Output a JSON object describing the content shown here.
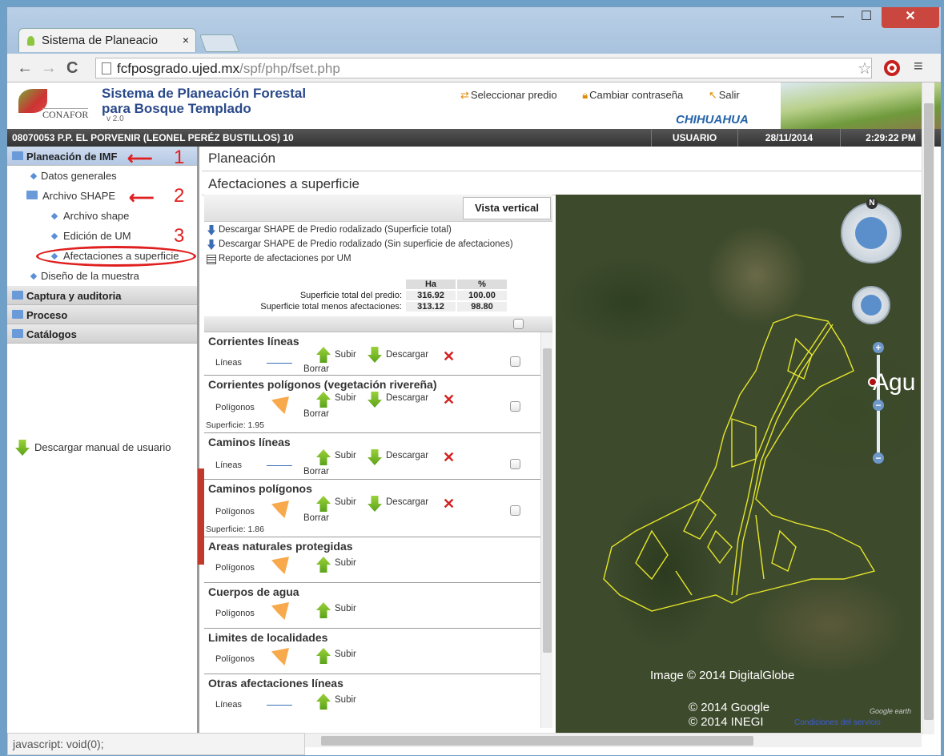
{
  "browser": {
    "tab_title": "Sistema de Planeacio",
    "tab_close": "×",
    "url_host": "fcfposgrado.ujed.mx",
    "url_path": "/spf/php/fset.php",
    "status_text": "javascript: void(0);"
  },
  "header": {
    "logo_text": "CONAFOR",
    "app_title_line1": "Sistema de Planeación Forestal",
    "app_title_line2": "para Bosque Templado",
    "version": "v 2.0",
    "links": [
      "Seleccionar predio",
      "Cambiar contraseña",
      "Salir"
    ],
    "state": "CHIHUAHUA"
  },
  "infobar": {
    "predio": "08070053 P.P. EL PORVENIR (LEONEL PERÉZ BUSTILLOS) 10",
    "user": "USUARIO",
    "date": "28/11/2014",
    "time": "2:29:22 PM"
  },
  "sidebar": {
    "planeacion": "Planeación de IMF",
    "datos_generales": "Datos generales",
    "archivo_shape_folder": "Archivo SHAPE",
    "archivo_shape": "Archivo shape",
    "edicion_um": "Edición de UM",
    "afectaciones": "Afectaciones a superficie",
    "diseno": "Diseño de la muestra",
    "captura": "Captura y auditoria",
    "proceso": "Proceso",
    "catalogos": "Catálogos",
    "manual": "Descargar manual de usuario",
    "annot_1": "1",
    "annot_2": "2",
    "annot_3": "3"
  },
  "main": {
    "title": "Planeación",
    "subtitle": "Afectaciones a superficie",
    "vista_btn": "Vista vertical",
    "dl1": "Descargar SHAPE de Predio rodalizado (Superficie total)",
    "dl2": "Descargar SHAPE de Predio rodalizado (Sin superficie de afectaciones)",
    "report": "Reporte de afectaciones por UM",
    "sup_table": {
      "col_ha": "Ha",
      "col_pct": "%",
      "row1_label": "Superficie total del predio:",
      "row1_ha": "316.92",
      "row1_pct": "100.00",
      "row2_label": "Superficie total menos afectaciones:",
      "row2_ha": "313.12",
      "row2_pct": "98.80"
    },
    "sections": [
      {
        "title": "Corrientes líneas",
        "type": "Líneas",
        "upload": "Subir",
        "download": "Descargar",
        "delete": "Borrar",
        "area": ""
      },
      {
        "title": "Corrientes polígonos (vegetación rivereña)",
        "type": "Polígonos",
        "upload": "Subir",
        "download": "Descargar",
        "delete": "Borrar",
        "area": "Superficie: 1.95"
      },
      {
        "title": "Caminos líneas",
        "type": "Líneas",
        "upload": "Subir",
        "download": "Descargar",
        "delete": "Borrar",
        "area": ""
      },
      {
        "title": "Caminos polígonos",
        "type": "Polígonos",
        "upload": "Subir",
        "download": "Descargar",
        "delete": "Borrar",
        "area": "Superficie: 1.86"
      },
      {
        "title": "Areas naturales protegidas",
        "type": "Polígonos",
        "upload": "Subir"
      },
      {
        "title": "Cuerpos de agua",
        "type": "Polígonos",
        "upload": "Subir"
      },
      {
        "title": "Limites de localidades",
        "type": "Polígonos",
        "upload": "Subir"
      },
      {
        "title": "Otras afectaciones líneas",
        "type": "Líneas",
        "upload": "Subir"
      }
    ]
  },
  "map": {
    "place_label": "Agu",
    "compass_n": "N",
    "image_credit": "Image © 2014 DigitalGlobe",
    "google_credit": "© 2014 Google",
    "inegi_credit": "© 2014 INEGI",
    "terms": "Condiciones del servicio",
    "ge_logo": "Google earth"
  },
  "colors": {
    "accent_red": "#e02020",
    "header_blue": "#2b4a8a",
    "state_blue": "#2563a8"
  }
}
